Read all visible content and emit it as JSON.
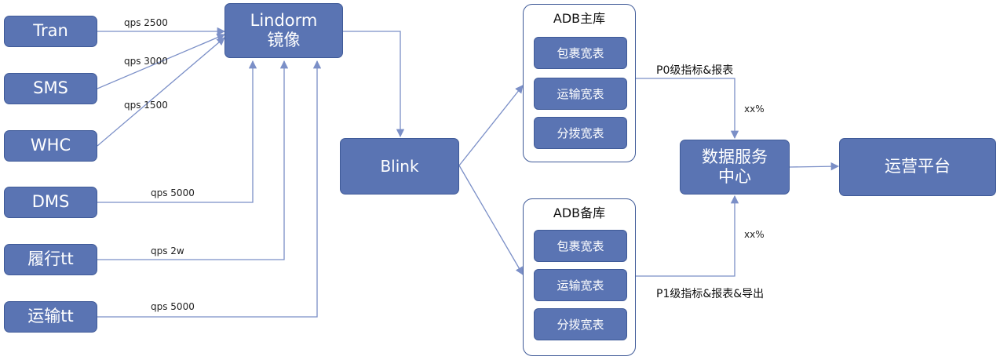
{
  "sources": {
    "tran": "Tran",
    "sms": "SMS",
    "whc": "WHC",
    "dms": "DMS",
    "lvxing": "履行tt",
    "yunshu": "运输tt"
  },
  "qps_labels": {
    "tran": "qps 2500",
    "sms": "qps 3000",
    "whc": "qps 1500",
    "dms": "qps 5000",
    "lvxing": "qps 2w",
    "yunshu": "qps 5000"
  },
  "lindorm": {
    "line1": "Lindorm",
    "line2": "镜像"
  },
  "blink": "Blink",
  "adb_primary": {
    "title": "ADB主库",
    "tables": [
      "包裹宽表",
      "运输宽表",
      "分拨宽表"
    ]
  },
  "adb_backup": {
    "title": "ADB备库",
    "tables": [
      "包裹宽表",
      "运输宽表",
      "分拨宽表"
    ]
  },
  "edge_labels": {
    "p0": "P0级指标&报表",
    "p1": "P1级指标&报表&导出",
    "xx_top": "xx%",
    "xx_bottom": "xx%"
  },
  "data_service": {
    "line1": "数据服务",
    "line2": "中心"
  },
  "ops_platform": "运营平台",
  "colors": {
    "node_fill": "#5a74b3",
    "node_border": "#3f5a98",
    "arrow": "#7b8fc7"
  }
}
